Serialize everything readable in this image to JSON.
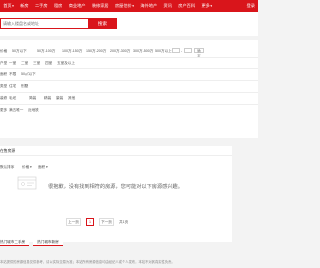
{
  "topnav": {
    "items": [
      {
        "label": "首页"
      },
      {
        "label": "新房"
      },
      {
        "label": "二手房"
      },
      {
        "label": "租房"
      },
      {
        "label": "商业地产"
      },
      {
        "label": "装修家居"
      },
      {
        "label": "房屋估价"
      },
      {
        "label": "海外地产"
      },
      {
        "label": "资讯"
      },
      {
        "label": "房产百科"
      },
      {
        "label": "更多"
      }
    ],
    "right_label": "登录"
  },
  "search": {
    "placeholder": "请输入楼盘名或地址",
    "button_label": "搜索"
  },
  "filters": {
    "price_label": "价格",
    "price_options": [
      "50万以下",
      "50万-100万",
      "100万-150万",
      "150万-200万",
      "200万-300万",
      "300万-500万",
      "500万以上"
    ],
    "price_min_placeholder": "",
    "price_max_placeholder": "",
    "price_confirm": "确定",
    "room_label": "户型",
    "room_options": [
      "一室",
      "二室",
      "三室",
      "四室",
      "五室及以上"
    ],
    "area_label": "面积",
    "area_options": [
      "不限",
      "50㎡以下"
    ],
    "type_label": "类型",
    "type_options": [
      "住宅",
      "别墅"
    ],
    "decoration_label": "装修",
    "decoration_options": [
      "毛坯",
      "简装",
      "精装",
      "豪装",
      "其他"
    ],
    "more_label": "更多",
    "more_options": [
      "满五唯一",
      "近地铁"
    ]
  },
  "results": {
    "title": "在售房源",
    "sort_label": "默认排序",
    "sort_price": "价格",
    "sort_area": "面积",
    "empty_message": "很抱歉，没有找到相符的房源，您可能对以下房源感兴趣。",
    "prev_label": "上一页",
    "current_page": "1",
    "next_label": "下一页",
    "page_total": "共1页"
  },
  "footer": {
    "tabs": [
      "热门城市二手房",
      "热门城市新房"
    ],
    "note": "本站提供的房源信息仅供参考，请以实际交易为准；本站所有房源信息均由经纪人或个人发布，本站不对其真实性负责。"
  },
  "colors": {
    "accent": "#d9151b",
    "background": "#f3f3f3"
  }
}
